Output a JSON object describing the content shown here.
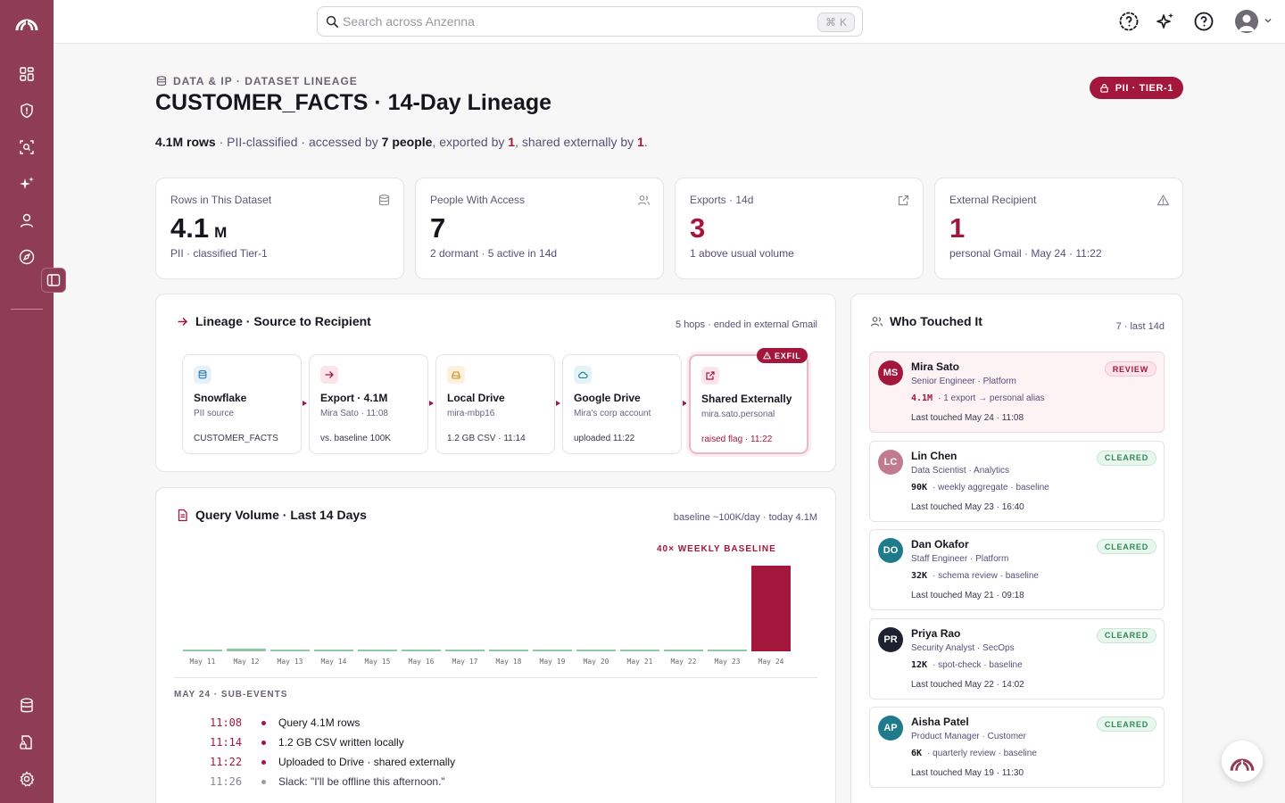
{
  "app": {
    "name": "Anzenna",
    "accent": "#8e3d55",
    "alert": "#a3173d"
  },
  "sidebar": {
    "logo_icon": "anzenna-logo-icon",
    "items": [
      {
        "icon": "dashboard-icon"
      },
      {
        "icon": "shield-icon"
      },
      {
        "icon": "scan-search-icon"
      },
      {
        "icon": "sparkles-icon"
      },
      {
        "icon": "user-icon"
      },
      {
        "icon": "compass-icon"
      }
    ],
    "bottom_items": [
      {
        "icon": "database-icon"
      },
      {
        "icon": "lock-file-icon"
      },
      {
        "icon": "gear-icon"
      }
    ]
  },
  "topbar": {
    "search_placeholder": "Search across Anzenna",
    "shortcut_symbol": "⌘",
    "shortcut_key": "K"
  },
  "header": {
    "breadcrumb": "DATA & IP · DATASET LINEAGE",
    "title": "CUSTOMER_FACTS · 14-Day Lineage",
    "badge": "PII · TIER-1",
    "summary": {
      "rows": "4.1M rows",
      "t1": " · PII-classified · accessed by ",
      "people": "7 people",
      "t2": ", exported by ",
      "exported": "1",
      "t3": ", shared externally by ",
      "shared": "1",
      "t4": "."
    }
  },
  "stats": [
    {
      "label": "Rows in This Dataset",
      "value": "4.1",
      "unit": "M",
      "sub": "PII · classified Tier-1",
      "icon": "database-icon"
    },
    {
      "label": "People With Access",
      "value": "7",
      "unit": "",
      "sub": "2 dormant · 5 active in 14d",
      "icon": "users-icon"
    },
    {
      "label": "Exports · 14d",
      "value": "3",
      "unit": "",
      "sub": "1 above usual volume",
      "icon": "external-link-icon"
    },
    {
      "label": "External Recipient",
      "value": "1",
      "unit": "",
      "sub": "personal Gmail · May 24 · 11:22",
      "icon": "warning-icon"
    }
  ],
  "lineage": {
    "title": "Lineage · Source to Recipient",
    "meta": "5 hops · ended in external Gmail",
    "exfil_badge": "EXFIL",
    "nodes": [
      {
        "title": "Snowflake",
        "sub": "PII source",
        "foot": "CUSTOMER_FACTS",
        "icon": "database-icon"
      },
      {
        "title": "Export · 4.1M",
        "sub": "Mira Sato · 11:08",
        "foot": "vs. baseline 100K",
        "icon": "export-arrow-icon"
      },
      {
        "title": "Local Drive",
        "sub": "mira-mbp16",
        "foot": "1.2 GB CSV · 11:14",
        "icon": "hard-drive-icon"
      },
      {
        "title": "Google Drive",
        "sub": "Mira's corp account",
        "foot": "uploaded 11:22",
        "icon": "cloud-icon"
      },
      {
        "title": "Shared Externally",
        "sub": "mira.sato.personal",
        "foot": "raised flag · 11:22",
        "icon": "external-link-icon"
      }
    ]
  },
  "query_volume": {
    "title": "Query Volume · Last 14 Days",
    "meta": "baseline ~100K/day · today 4.1M",
    "annotation": "40× WEEKLY BASELINE",
    "sub_events_title": "MAY 24 · SUB-EVENTS",
    "events": [
      {
        "time": "11:08",
        "text": "Query 4.1M rows",
        "flagged": true
      },
      {
        "time": "11:14",
        "text": "1.2 GB CSV written locally",
        "flagged": true
      },
      {
        "time": "11:22",
        "text": "Uploaded to Drive · shared externally",
        "flagged": true
      },
      {
        "time": "11:26",
        "text": "Slack: \"I'll be offline this afternoon.\"",
        "flagged": false
      }
    ]
  },
  "chart_data": {
    "type": "bar",
    "title": "Query Volume · Last 14 Days",
    "categories": [
      "May 11",
      "May 12",
      "May 13",
      "May 14",
      "May 15",
      "May 16",
      "May 17",
      "May 18",
      "May 19",
      "May 20",
      "May 21",
      "May 22",
      "May 23",
      "May 24"
    ],
    "series": [
      {
        "values": [
          95000,
          110000,
          100000,
          105000,
          100000,
          40000,
          35000,
          95000,
          105000,
          100000,
          100000,
          90000,
          30000,
          4100000
        ]
      }
    ],
    "ylim": [
      0,
      4200000
    ],
    "grid": false,
    "annotation": "40× WEEKLY BASELINE",
    "colors": {
      "baseline": "#8fc9a4",
      "spike": "#a3173d"
    }
  },
  "who_touched": {
    "title": "Who Touched It",
    "meta": "7 · last 14d",
    "people": [
      {
        "initials": "MS",
        "name": "Mira Sato",
        "role": "Senior Engineer · Platform",
        "metric": "4.1M",
        "detail": "· 1 export → personal alias",
        "last": "Last touched May 24 · 11:08",
        "badge": "REVIEW",
        "status": "review",
        "color": "#a3173d"
      },
      {
        "initials": "LC",
        "name": "Lin Chen",
        "role": "Data Scientist · Analytics",
        "metric": "90K",
        "detail": "· weekly aggregate · baseline",
        "last": "Last touched May 23 · 16:40",
        "badge": "CLEARED",
        "status": "cleared",
        "color": "#c27a8e"
      },
      {
        "initials": "DO",
        "name": "Dan Okafor",
        "role": "Staff Engineer · Platform",
        "metric": "32K",
        "detail": "· schema review · baseline",
        "last": "Last touched May 21 · 09:18",
        "badge": "CLEARED",
        "status": "cleared",
        "color": "#1f7a8c"
      },
      {
        "initials": "PR",
        "name": "Priya Rao",
        "role": "Security Analyst · SecOps",
        "metric": "12K",
        "detail": "· spot-check · baseline",
        "last": "Last touched May 22 · 14:02",
        "badge": "CLEARED",
        "status": "cleared",
        "color": "#1e2230"
      },
      {
        "initials": "AP",
        "name": "Aisha Patel",
        "role": "Product Manager · Customer",
        "metric": "6K",
        "detail": "· quarterly review · baseline",
        "last": "Last touched May 19 · 11:30",
        "badge": "CLEARED",
        "status": "cleared",
        "color": "#1f7a8c"
      }
    ]
  }
}
